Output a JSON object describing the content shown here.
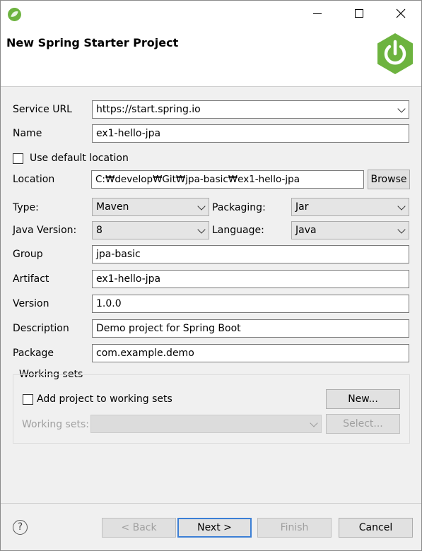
{
  "header": {
    "title": "New Spring Starter Project"
  },
  "form": {
    "service_url": {
      "label": "Service URL",
      "value": "https://start.spring.io"
    },
    "name": {
      "label": "Name",
      "value": "ex1-hello-jpa"
    },
    "use_default_location": {
      "label": "Use default location",
      "checked": false
    },
    "location": {
      "label": "Location",
      "value": "C:₩develop₩Git₩jpa-basic₩ex1-hello-jpa",
      "browse_label": "Browse"
    },
    "type": {
      "label": "Type:",
      "value": "Maven"
    },
    "packaging": {
      "label": "Packaging:",
      "value": "Jar"
    },
    "java_version": {
      "label": "Java Version:",
      "value": "8"
    },
    "language": {
      "label": "Language:",
      "value": "Java"
    },
    "group": {
      "label": "Group",
      "value": "jpa-basic"
    },
    "artifact": {
      "label": "Artifact",
      "value": "ex1-hello-jpa"
    },
    "version": {
      "label": "Version",
      "value": "1.0.0"
    },
    "description": {
      "label": "Description",
      "value": "Demo project for Spring Boot"
    },
    "package": {
      "label": "Package",
      "value": "com.example.demo"
    }
  },
  "working_sets": {
    "title": "Working sets",
    "add_label": "Add project to working sets",
    "new_button": "New...",
    "sets_label": "Working sets:",
    "select_button": "Select..."
  },
  "footer": {
    "help_icon": "?",
    "back": "< Back",
    "next": "Next >",
    "finish": "Finish",
    "cancel": "Cancel"
  },
  "colors": {
    "spring_green": "#6db33f",
    "default_button_border": "#3c7fd5"
  }
}
